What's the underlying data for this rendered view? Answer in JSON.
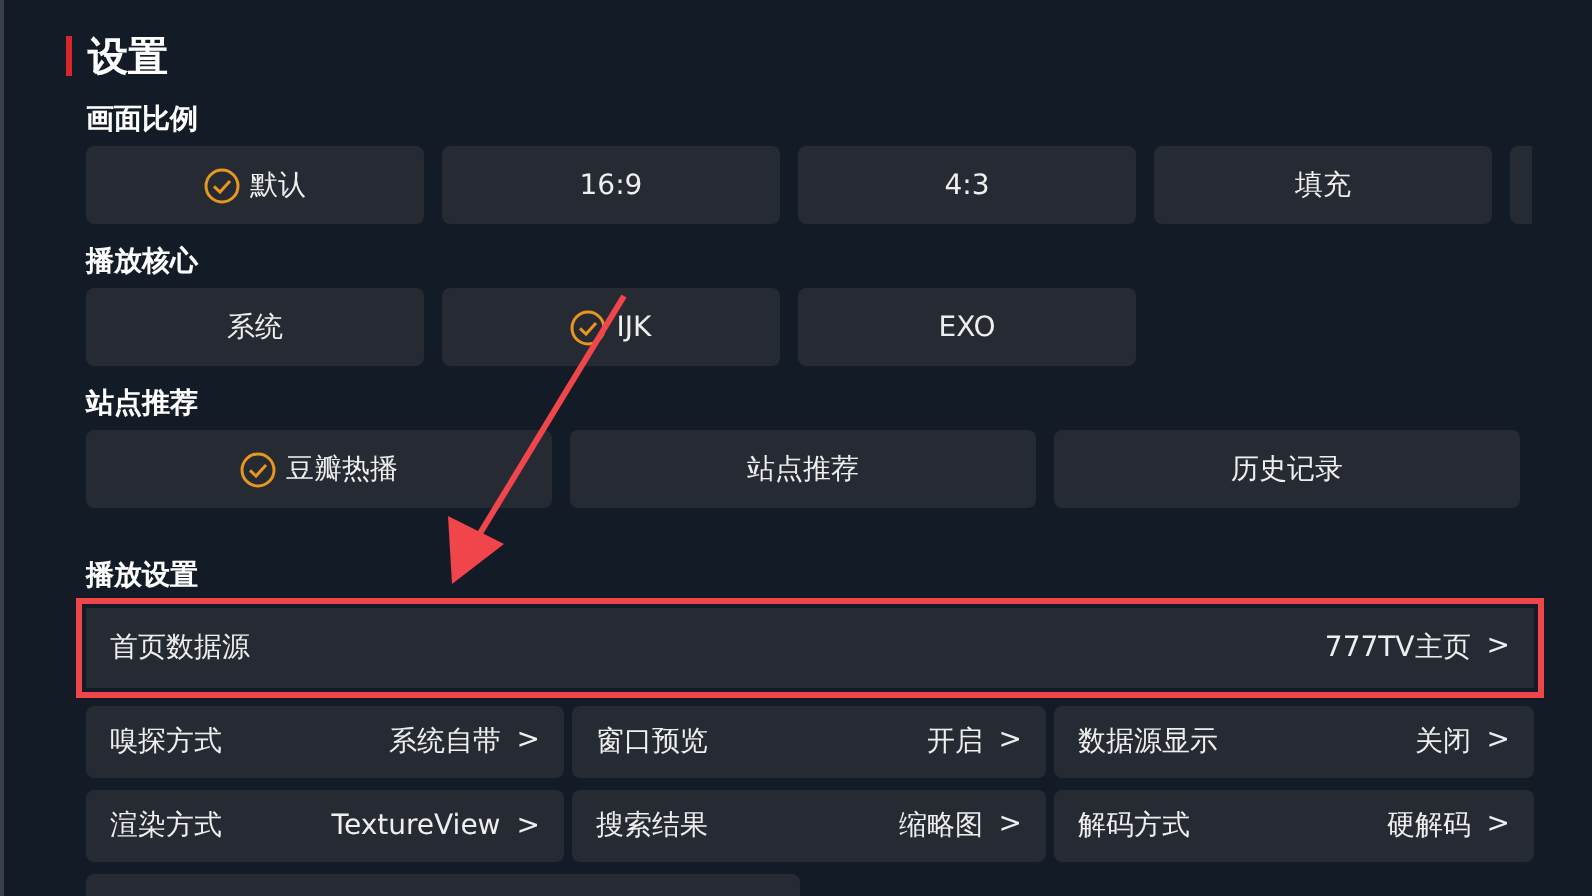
{
  "title": "设置",
  "sections": [
    {
      "label": "画面比例",
      "options": [
        {
          "label": "默认",
          "selected": true
        },
        {
          "label": "16:9",
          "selected": false
        },
        {
          "label": "4:3",
          "selected": false
        },
        {
          "label": "填充",
          "selected": false
        }
      ],
      "cut_option": true
    },
    {
      "label": "播放核心",
      "options": [
        {
          "label": "系统",
          "selected": false
        },
        {
          "label": "IJK",
          "selected": true
        },
        {
          "label": "EXO",
          "selected": false
        }
      ]
    },
    {
      "label": "站点推荐",
      "wide": true,
      "options": [
        {
          "label": "豆瓣热播",
          "selected": true
        },
        {
          "label": "站点推荐",
          "selected": false
        },
        {
          "label": "历史记录",
          "selected": false
        }
      ]
    }
  ],
  "playback": {
    "label": "播放设置",
    "main": {
      "label": "首页数据源",
      "value": "777TV主页",
      "chevron": ">",
      "highlighted": true
    },
    "rows": [
      {
        "label": "嗅探方式",
        "value": "系统自带",
        "chevron": ">"
      },
      {
        "label": "窗口预览",
        "value": "开启",
        "chevron": ">"
      },
      {
        "label": "数据源显示",
        "value": "关闭",
        "chevron": ">"
      },
      {
        "label": "渲染方式",
        "value": "TextureView",
        "chevron": ">"
      },
      {
        "label": "搜索结果",
        "value": "缩略图",
        "chevron": ">"
      },
      {
        "label": "解码方式",
        "value": "硬解码",
        "chevron": ">"
      }
    ]
  }
}
